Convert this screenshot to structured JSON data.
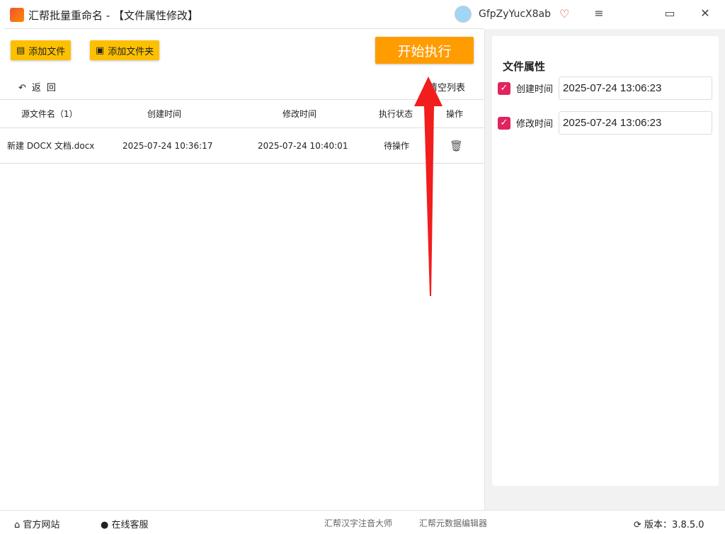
{
  "app": {
    "title": "汇帮批量重命名 - 【文件属性修改】",
    "username": "GfpZyYucX8ab"
  },
  "toolbar": {
    "add_file": "添加文件",
    "add_folder": "添加文件夹",
    "start": "开始执行",
    "back": "返回",
    "clear": "清空列表"
  },
  "table": {
    "headers": [
      "源文件名（1）",
      "创建时间",
      "修改时间",
      "执行状态",
      "操作"
    ],
    "rows": [
      {
        "name": "新建 DOCX 文档.docx",
        "created": "2025-07-24 10:36:17",
        "modified": "2025-07-24 10:40:01",
        "status": "待操作"
      }
    ]
  },
  "panel": {
    "title": "文件属性",
    "created_label": "创建时间",
    "created_value": "2025-07-24 13:06:23",
    "modified_label": "修改时间",
    "modified_value": "2025-07-24 13:06:23"
  },
  "footer": {
    "website": "官方网站",
    "support": "在线客服",
    "link1": "汇帮汉字注音大师",
    "link2": "汇帮元数据编辑器",
    "version": "版本：3.8.5.0"
  }
}
